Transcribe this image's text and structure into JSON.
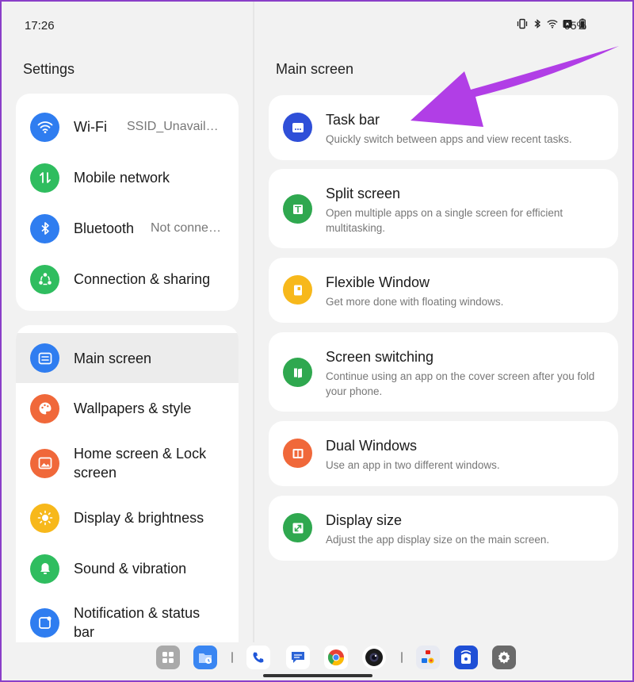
{
  "status_bar": {
    "time": "17:26",
    "battery": "95%",
    "icons": [
      "vibrate-icon",
      "bluetooth-icon",
      "wifi-icon",
      "sim-icon",
      "battery-icon"
    ]
  },
  "left_pane": {
    "title": "Settings",
    "group1": [
      {
        "label": "Wi-Fi",
        "value": "SSID_Unavailable",
        "icon": "wifi-icon",
        "color": "#2f7df0"
      },
      {
        "label": "Mobile network",
        "value": "",
        "icon": "mobile-network-icon",
        "color": "#2fbd5f"
      },
      {
        "label": "Bluetooth",
        "value": "Not connec…",
        "icon": "bluetooth-icon",
        "color": "#2f7df0"
      },
      {
        "label": "Connection & sharing",
        "value": "",
        "icon": "sharing-icon",
        "color": "#2fbd5f"
      }
    ],
    "group2": [
      {
        "label": "Main screen",
        "icon": "main-screen-icon",
        "color": "#2f7df0",
        "selected": true
      },
      {
        "label": "Wallpapers & style",
        "icon": "palette-icon",
        "color": "#f0683a"
      },
      {
        "label": "Home screen & Lock screen",
        "icon": "image-icon",
        "color": "#f0683a"
      },
      {
        "label": "Display & brightness",
        "icon": "sun-icon",
        "color": "#f7b81b"
      },
      {
        "label": "Sound & vibration",
        "icon": "bell-icon",
        "color": "#2fbd5f"
      },
      {
        "label": "Notification & status bar",
        "icon": "notification-icon",
        "color": "#2f7df0"
      }
    ]
  },
  "right_pane": {
    "title": "Main screen",
    "items": [
      {
        "title": "Task bar",
        "subtitle": "Quickly switch between apps and view recent tasks.",
        "icon": "taskbar-icon",
        "color": "#2f4fd8"
      },
      {
        "title": "Split screen",
        "subtitle": "Open multiple apps on a single screen for efficient multitasking.",
        "icon": "split-screen-icon",
        "color": "#2fa84f"
      },
      {
        "title": "Flexible Window",
        "subtitle": "Get more done with floating windows.",
        "icon": "flexible-window-icon",
        "color": "#f7b81b"
      },
      {
        "title": "Screen switching",
        "subtitle": "Continue using an app on the cover screen after you fold your phone.",
        "icon": "screen-switch-icon",
        "color": "#2fa84f"
      },
      {
        "title": "Dual Windows",
        "subtitle": "Use an app in two different windows.",
        "icon": "dual-windows-icon",
        "color": "#f0683a"
      },
      {
        "title": "Display size",
        "subtitle": "Adjust the app display size on the main screen.",
        "icon": "display-size-icon",
        "color": "#2fa84f"
      }
    ]
  },
  "dock": {
    "apps": [
      "app-drawer-icon",
      "files-icon",
      "phone-icon",
      "messages-icon",
      "chrome-icon",
      "camera-icon",
      "app-folder-icon",
      "remote-icon",
      "settings-icon"
    ]
  },
  "annotation": {
    "arrow_color": "#b13ee6"
  }
}
